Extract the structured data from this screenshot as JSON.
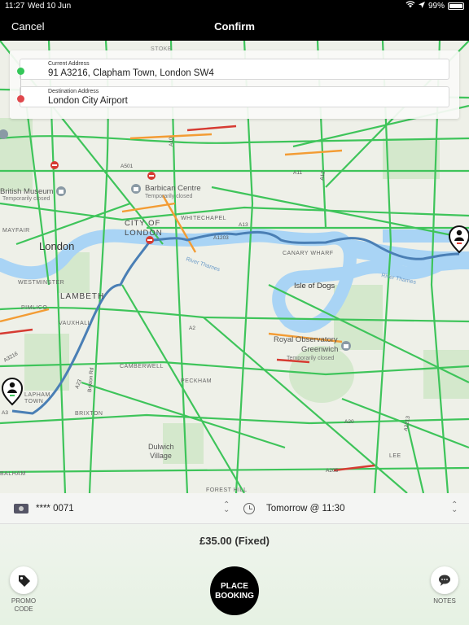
{
  "status_bar": {
    "time": "11:27",
    "date": "Wed 10 Jun",
    "battery": "99%"
  },
  "nav": {
    "cancel": "Cancel",
    "title": "Confirm"
  },
  "addresses": {
    "current_label": "Current Address",
    "current_value": "91 A3216, Clapham Town, London SW4",
    "destination_label": "Destination Address",
    "destination_value": "London City Airport"
  },
  "map": {
    "labels": {
      "london": "London",
      "city_of": "CITY OF",
      "london_city": "LONDON",
      "lambeth": "LAMBETH",
      "british_museum": "British Museum",
      "temporarily_closed": "Temporarily closed",
      "barbican": "Barbican Centre",
      "whitechapel": "WHITECHAPEL",
      "canary_wharf": "CANARY WHARF",
      "isle_of_dogs": "Isle of Dogs",
      "royal_observatory": "Royal Observatory",
      "greenwich": "Greenwich",
      "camberwell": "CAMBERWELL",
      "peckham": "PECKHAM",
      "dulwich": "Dulwich",
      "village": "Village",
      "clapham": "LAPHAM",
      "town": "TOWN",
      "brixton": "BRIXTON",
      "westminster": "WESTMINSTER",
      "vauxhall": "VAUXHALL",
      "pimlico": "PIMLICO",
      "mayfair": "MAYFAIR",
      "river_thames": "River Thames",
      "river_thames2": "River Thames",
      "stoke": "STOKE",
      "forest_hill": "FOREST HILL",
      "balham": "BALHAM",
      "lee": "LEE",
      "a10": "A10",
      "a11": "A11",
      "a12": "A12",
      "a13": "A13",
      "a1203": "A1203",
      "a501": "A501",
      "a2": "A2",
      "a20": "A20",
      "a205": "A205",
      "a2213": "A2213",
      "a3": "A3",
      "a23": "A23",
      "a3216": "A3216",
      "brixton_rd": "Brixton Rd"
    }
  },
  "payment": {
    "card": "**** 0071",
    "when": "Tomorrow @ 11:30"
  },
  "price": "£35.00 (Fixed)",
  "actions": {
    "promo_line1": "PROMO",
    "promo_line2": "CODE",
    "place_line1": "PLACE",
    "place_line2": "BOOKING",
    "notes": "NOTES"
  },
  "colors": {
    "route": "#4a7fb5",
    "traffic_green": "#3ec45a",
    "traffic_orange": "#f39c34",
    "traffic_red": "#d63b32",
    "water": "#a9d4f5",
    "park": "#cde6c4"
  }
}
